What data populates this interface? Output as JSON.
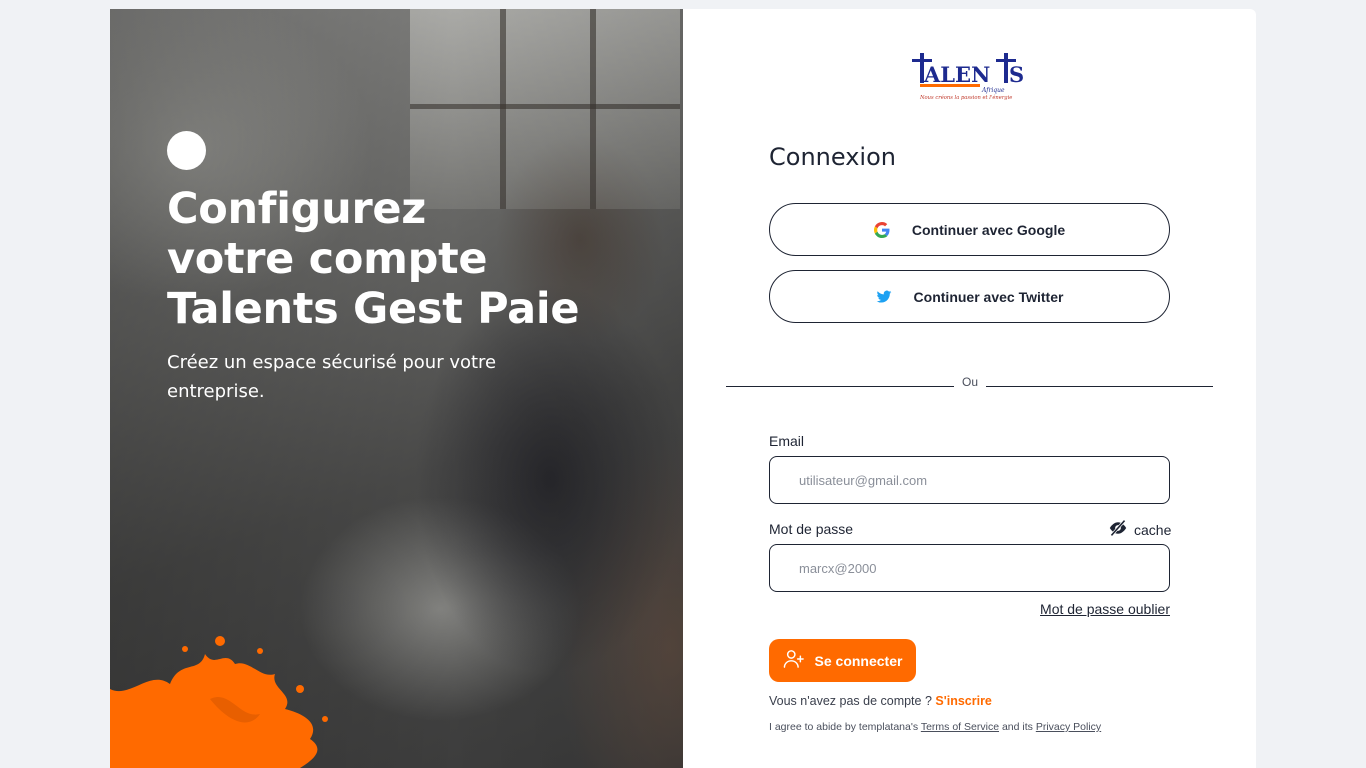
{
  "hero": {
    "title_line1": "Configurez",
    "title_line2": "votre compte",
    "title_line3": "Talents Gest Paie",
    "subtitle": "Créez un espace sécurisé pour votre entreprise."
  },
  "logo": {
    "brand": "TALENTS",
    "sub": "Afrique",
    "tagline": "Nous créons la passion et l'énergie"
  },
  "login": {
    "heading": "Connexion",
    "google_label": "Continuer avec Google",
    "twitter_label": "Continuer avec Twitter",
    "divider": "Ou",
    "email_label": "Email",
    "email_placeholder": "utilisateur@gmail.com",
    "password_label": "Mot de passe",
    "password_placeholder": "marcx@2000",
    "hide_label": "cache",
    "forgot_label": "Mot de passe oublier",
    "submit_label": "Se connecter",
    "no_account_text": "Vous n'avez pas de compte ?",
    "signup_label": "S'inscrire",
    "terms_prefix": "I agree to abide by templatana's",
    "terms_link": "Terms of Service",
    "terms_mid": "and its",
    "privacy_link": "Privacy Policy"
  },
  "colors": {
    "accent": "#ff6a00",
    "text": "#1e2433",
    "background": "#f0f2f5",
    "twitter": "#1da1f2"
  },
  "icons": [
    "google-icon",
    "twitter-icon",
    "eye-slash-icon",
    "user-plus-icon"
  ]
}
